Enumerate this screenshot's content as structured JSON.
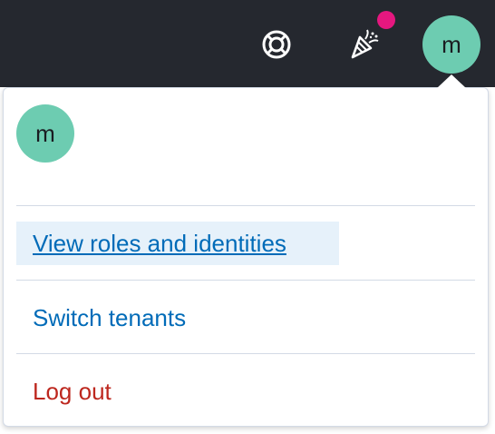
{
  "header": {
    "avatar_initial": "m",
    "help_icon": "lifebuoy-icon",
    "news_icon": "party-popper-icon",
    "notification_dot_color": "#e5177f",
    "background_color": "#25282f"
  },
  "user_menu": {
    "avatar_initial": "m",
    "avatar_color": "#6dccb1",
    "items": [
      {
        "label": "View roles and identities"
      },
      {
        "label": "Switch tenants"
      },
      {
        "label": "Log out"
      }
    ],
    "link_color": "#006bb8",
    "logout_color": "#bd271e"
  }
}
